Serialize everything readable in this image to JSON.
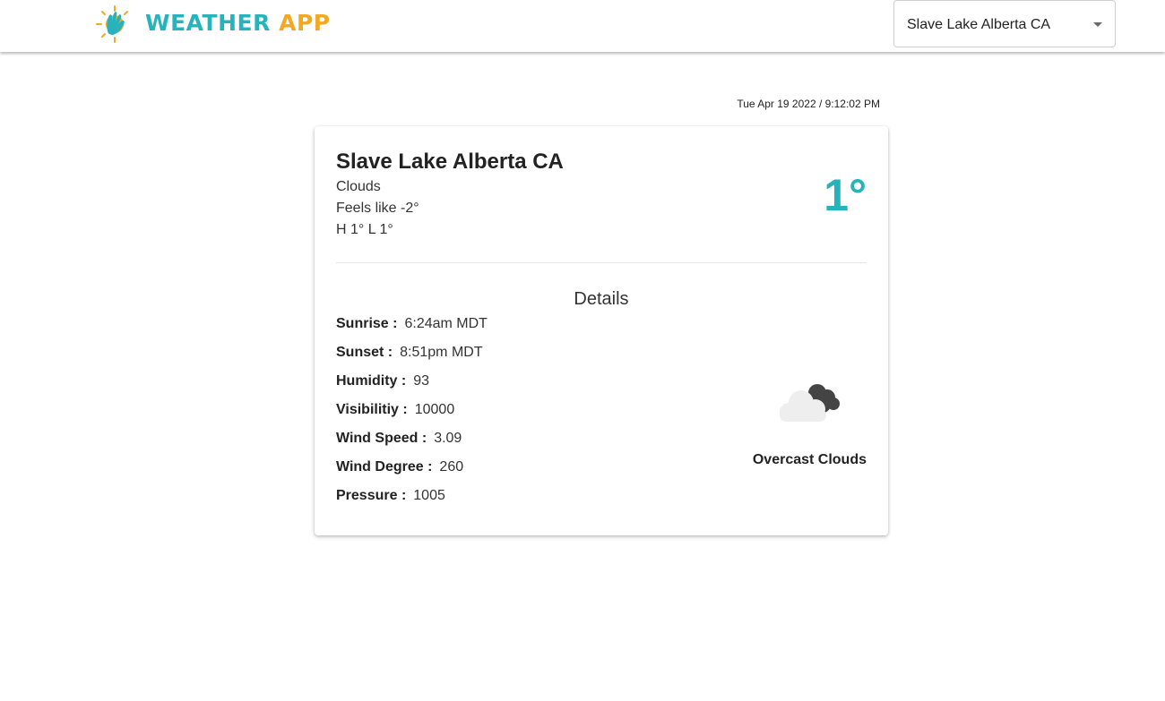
{
  "header": {
    "brand_word1": "WEATHER",
    "brand_word2": "APP",
    "location_select": {
      "value": "Slave Lake Alberta CA"
    }
  },
  "datetime": "Tue Apr 19 2022 / 9:12:02 PM",
  "card": {
    "city": "Slave Lake Alberta CA",
    "condition": "Clouds",
    "feels_like": "Feels like -2°",
    "high_low": "H 1° L 1°",
    "temperature": "1°",
    "details_title": "Details",
    "details": [
      {
        "key": "Sunrise :",
        "value": "6:24am MDT"
      },
      {
        "key": "Sunset :",
        "value": "8:51pm MDT"
      },
      {
        "key": "Humidity :",
        "value": "93"
      },
      {
        "key": "Visibilitiy :",
        "value": "10000"
      },
      {
        "key": "Wind Speed :",
        "value": "3.09"
      },
      {
        "key": "Wind Degree :",
        "value": "260"
      },
      {
        "key": "Pressure :",
        "value": "1005"
      }
    ],
    "condition_icon": "overcast-clouds-icon",
    "condition_label": "Overcast Clouds"
  },
  "colors": {
    "accent_teal": "#27b3bb",
    "accent_orange": "#f2a823"
  }
}
